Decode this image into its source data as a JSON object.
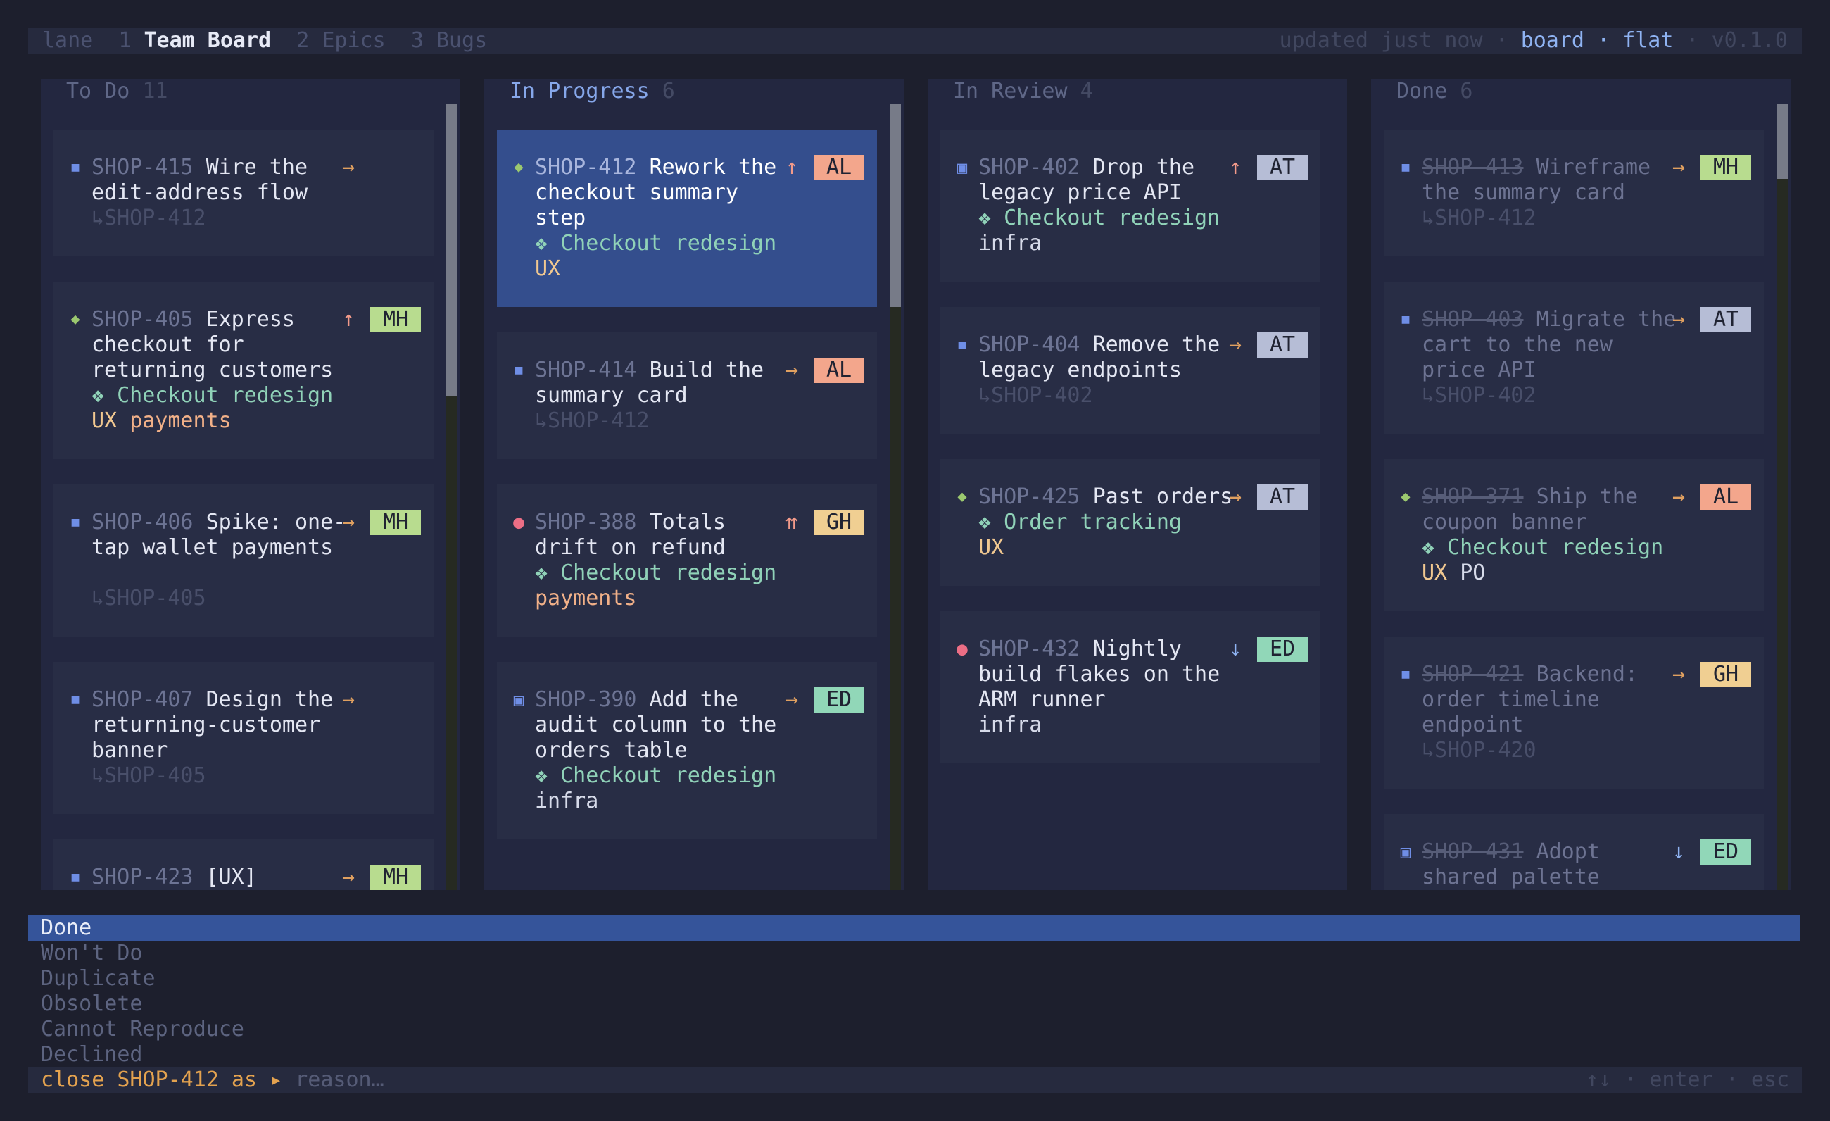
{
  "topbar": {
    "lane_label": "lane",
    "tabs": [
      {
        "num": "1",
        "label": "Team Board",
        "active": true
      },
      {
        "num": "2",
        "label": "Epics",
        "active": false
      },
      {
        "num": "3",
        "label": "Bugs",
        "active": false
      }
    ],
    "status": "updated just now",
    "sep": "·",
    "mode_board": "board",
    "mode_flat": "flat",
    "version": "v0.1.0"
  },
  "icons": {
    "task": "square-icon",
    "story": "diamond-icon",
    "bug": "circle-icon",
    "subtask": "boxed-square-icon",
    "epic": "epic-diamond-icon"
  },
  "colors": {
    "task": "#6f8ee6",
    "story": "#9bc86f",
    "bug": "#ec6e85",
    "prio_high": "#f29a8a",
    "prio_medium": "#e0a060",
    "prio_low": "#8fb3f2",
    "badge_AL": "#f3a68c",
    "badge_MH": "#b8dc8f",
    "badge_AT": "#b6bdd6",
    "badge_GH": "#f0cf92",
    "badge_ED": "#91d7b8"
  },
  "columns": [
    {
      "title": "To Do",
      "count": "11",
      "cards": [
        {
          "type": "task",
          "id": "SHOP-415",
          "lines": [
            "Wire the",
            "edit-address flow"
          ],
          "prio": "→",
          "prio_level": "medium",
          "assignee": "",
          "parent": "↳SHOP-412"
        },
        {
          "type": "story",
          "id": "SHOP-405",
          "lines": [
            "Express",
            "checkout for",
            "returning customers"
          ],
          "prio": "↑",
          "prio_level": "high",
          "assignee": "MH",
          "epic": "❖ Checkout redesign",
          "labels": [
            "UX",
            "payments"
          ]
        },
        {
          "type": "task",
          "id": "SHOP-406",
          "lines": [
            "Spike: one-",
            "tap wallet payments"
          ],
          "prio": "→",
          "prio_level": "medium",
          "assignee": "MH",
          "parent": "↳SHOP-405"
        },
        {
          "type": "task",
          "id": "SHOP-407",
          "lines": [
            "Design the",
            "returning-customer",
            "banner"
          ],
          "prio": "→",
          "prio_level": "medium",
          "assignee": "",
          "parent": "↳SHOP-405"
        },
        {
          "type": "task",
          "id": "SHOP-423",
          "lines": [
            "[UX]"
          ],
          "prio": "→",
          "prio_level": "medium",
          "assignee": "MH"
        }
      ]
    },
    {
      "title": "In Progress",
      "count": "6",
      "cards": [
        {
          "type": "story",
          "id": "SHOP-412",
          "lines": [
            "Rework the",
            "checkout summary",
            "step"
          ],
          "prio": "↑",
          "prio_level": "high",
          "assignee": "AL",
          "epic": "❖ Checkout redesign",
          "labels": [
            "UX"
          ],
          "selected": true
        },
        {
          "type": "task",
          "id": "SHOP-414",
          "lines": [
            "Build the",
            "summary card"
          ],
          "prio": "→",
          "prio_level": "medium",
          "assignee": "AL",
          "parent": "↳SHOP-412"
        },
        {
          "type": "bug",
          "id": "SHOP-388",
          "lines": [
            "Totals",
            "drift on refund"
          ],
          "prio": "⇈",
          "prio_level": "high",
          "assignee": "GH",
          "epic": "❖ Checkout redesign",
          "labels": [
            "payments"
          ]
        },
        {
          "type": "subtask",
          "id": "SHOP-390",
          "lines": [
            "Add the",
            "audit column to the",
            "orders table"
          ],
          "prio": "→",
          "prio_level": "medium",
          "assignee": "ED",
          "epic": "❖ Checkout redesign",
          "labels": [
            "infra"
          ]
        }
      ]
    },
    {
      "title": "In Review",
      "count": "4",
      "cards": [
        {
          "type": "subtask",
          "id": "SHOP-402",
          "lines": [
            "Drop the",
            "legacy price API"
          ],
          "prio": "↑",
          "prio_level": "high",
          "assignee": "AT",
          "epic": "❖ Checkout redesign",
          "labels": [
            "infra"
          ]
        },
        {
          "type": "task",
          "id": "SHOP-404",
          "lines": [
            "Remove the",
            "legacy endpoints"
          ],
          "prio": "→",
          "prio_level": "medium",
          "assignee": "AT",
          "parent": "↳SHOP-402"
        },
        {
          "type": "story",
          "id": "SHOP-425",
          "lines": [
            "Past orders"
          ],
          "prio": "→",
          "prio_level": "medium",
          "assignee": "AT",
          "epic": "❖ Order tracking",
          "labels": [
            "UX"
          ]
        },
        {
          "type": "bug",
          "id": "SHOP-432",
          "lines": [
            "Nightly",
            "build flakes on the",
            "ARM runner"
          ],
          "prio": "↓",
          "prio_level": "low",
          "assignee": "ED",
          "labels": [
            "infra"
          ]
        }
      ]
    },
    {
      "title": "Done",
      "count": "6",
      "cards": [
        {
          "type": "task",
          "id": "SHOP-413",
          "lines": [
            "Wireframe",
            "the summary card"
          ],
          "prio": "→",
          "prio_level": "medium",
          "assignee": "MH",
          "parent": "↳SHOP-412"
        },
        {
          "type": "task",
          "id": "SHOP-403",
          "lines": [
            "Migrate the",
            "cart to the new",
            "price API"
          ],
          "prio": "→",
          "prio_level": "medium",
          "assignee": "AT",
          "parent": "↳SHOP-402"
        },
        {
          "type": "story",
          "id": "SHOP-371",
          "lines": [
            "Ship the",
            "coupon banner"
          ],
          "prio": "→",
          "prio_level": "medium",
          "assignee": "AL",
          "epic": "❖ Checkout redesign",
          "labels": [
            "UX",
            "PO"
          ]
        },
        {
          "type": "task",
          "id": "SHOP-421",
          "lines": [
            "Backend:",
            "order timeline",
            "endpoint"
          ],
          "prio": "→",
          "prio_level": "medium",
          "assignee": "GH",
          "parent": "↳SHOP-420"
        },
        {
          "type": "subtask",
          "id": "SHOP-431",
          "lines": [
            "Adopt",
            "shared palette"
          ],
          "prio": "↓",
          "prio_level": "low",
          "assignee": "ED"
        }
      ]
    }
  ],
  "resolution_picker": {
    "options": [
      "Done",
      "Won't Do",
      "Duplicate",
      "Obsolete",
      "Cannot Reproduce",
      "Declined"
    ],
    "selected": "Done"
  },
  "prompt": {
    "lead": "close SHOP-412 as",
    "caret": "▸",
    "placeholder": "reason…",
    "hints": "↑↓ · enter · esc"
  }
}
